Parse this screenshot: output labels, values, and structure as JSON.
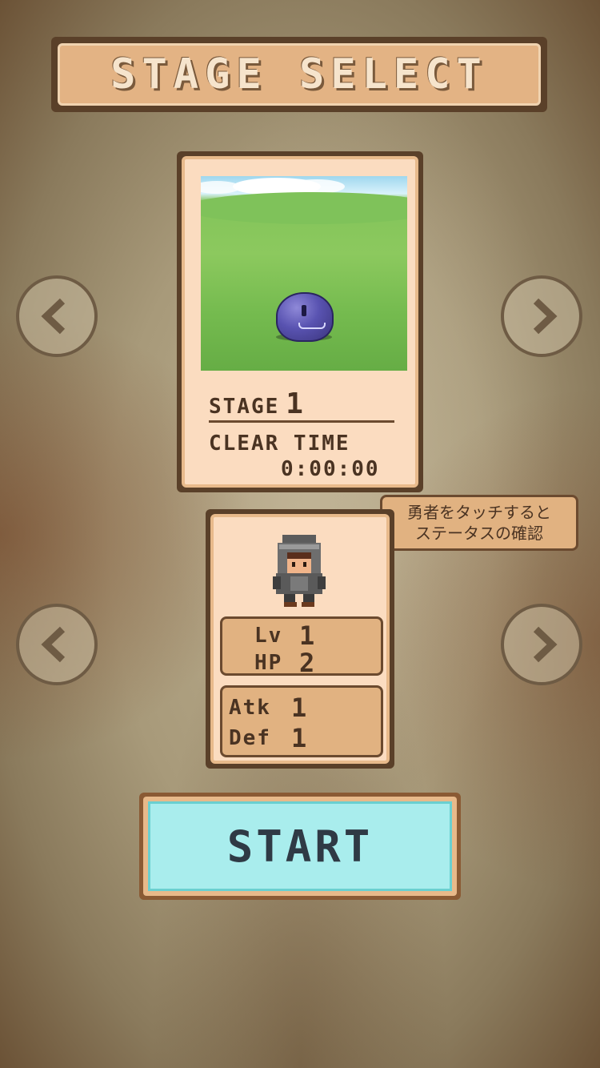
{
  "header": {
    "title": "STAGE SELECT"
  },
  "stage": {
    "label": "STAGE",
    "number": "1",
    "clear_label": "CLEAR TIME",
    "clear_time": "0:00:00"
  },
  "hero": {
    "lv_label": "Lv",
    "lv_value": "1",
    "hp_label": "HP",
    "hp_value": "2",
    "atk_label": "Atk",
    "atk_value": "1",
    "def_label": "Def",
    "def_value": "1"
  },
  "tooltip": {
    "line1": "勇者をタッチすると",
    "line2": "ステータスの確認"
  },
  "buttons": {
    "start_label": "START"
  },
  "icons": {
    "stage_prev": "chevron-left-icon",
    "stage_next": "chevron-right-icon",
    "hero_prev": "chevron-left-icon",
    "hero_next": "chevron-right-icon"
  },
  "colors": {
    "start_bg": "#a9eded",
    "panel": "#fbdcc0",
    "frame": "#5a4029"
  }
}
